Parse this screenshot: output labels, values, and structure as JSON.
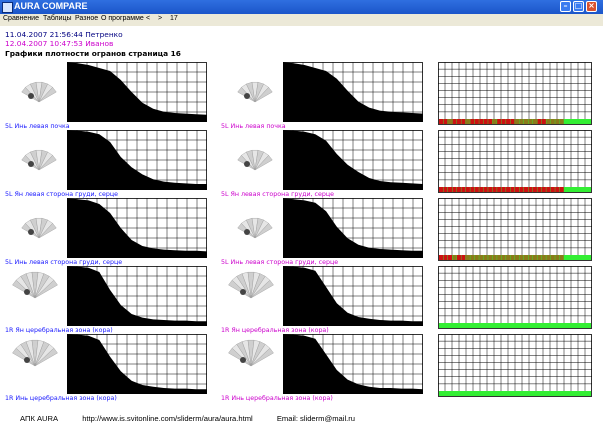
{
  "window": {
    "title": "AURA COMPARE"
  },
  "menu": [
    "Сравнение",
    "Таблицы",
    "Разное",
    "О программе",
    "<",
    ">",
    "17"
  ],
  "header": {
    "record1": "11.04.2007 21:56:44 Петренко",
    "record2": "12.04.2007 10:47:53 Иванов",
    "heading": "Графики плотности огранов  страница 16"
  },
  "colors": {
    "record1": "#000080",
    "record2": "#cc00cc",
    "band_green": "#33ee33",
    "band_red": "#cc1111",
    "band_olive": "#8a7a1a"
  },
  "rows": [
    {
      "left": {
        "label": "5L Инь левая почка",
        "color": "#1a1aff",
        "thumb": "fan-small",
        "curve": [
          1.0,
          0.98,
          0.95,
          0.9,
          0.85,
          0.7,
          0.5,
          0.32,
          0.22,
          0.17,
          0.15,
          0.14,
          0.13,
          0.12
        ]
      },
      "right": {
        "label": "5L Инь левая почка",
        "color": "#cc00cc",
        "thumb": "fan-small",
        "curve": [
          1.0,
          0.98,
          0.95,
          0.9,
          0.85,
          0.72,
          0.52,
          0.34,
          0.24,
          0.19,
          0.17,
          0.16,
          0.15,
          0.14
        ]
      },
      "strip": {
        "band": "mixed",
        "pattern": [
          1,
          1,
          0,
          1,
          1,
          1,
          0,
          1,
          1,
          1,
          1,
          1,
          0,
          1,
          1,
          1,
          1,
          0,
          0,
          0,
          0,
          0,
          1,
          1,
          0,
          0,
          0,
          0
        ]
      }
    },
    {
      "left": {
        "label": "5L Ян левая сторона груди, серце",
        "color": "#1a1aff",
        "thumb": "fan-small",
        "curve": [
          1.0,
          0.99,
          0.97,
          0.93,
          0.8,
          0.55,
          0.38,
          0.26,
          0.18,
          0.14,
          0.12,
          0.11,
          0.1,
          0.1
        ]
      },
      "right": {
        "label": "5L Ян левая сторона груди, серце",
        "color": "#cc00cc",
        "thumb": "fan-small",
        "curve": [
          1.0,
          0.99,
          0.97,
          0.93,
          0.82,
          0.6,
          0.42,
          0.3,
          0.2,
          0.15,
          0.13,
          0.12,
          0.11,
          0.1
        ]
      },
      "strip": {
        "band": "mixed",
        "pattern": [
          1,
          1,
          1,
          1,
          1,
          1,
          1,
          1,
          1,
          1,
          1,
          1,
          1,
          1,
          1,
          1,
          1,
          1,
          1,
          1,
          1,
          1,
          1,
          1,
          1,
          1,
          1,
          1
        ]
      }
    },
    {
      "left": {
        "label": "5L Инь левая сторона груди, серце",
        "color": "#1a1aff",
        "thumb": "fan-small",
        "curve": [
          1.0,
          0.98,
          0.96,
          0.9,
          0.75,
          0.5,
          0.3,
          0.2,
          0.16,
          0.14,
          0.13,
          0.12,
          0.12,
          0.11
        ]
      },
      "right": {
        "label": "5L Инь левая сторона груди, серце",
        "color": "#cc00cc",
        "thumb": "fan-small",
        "curve": [
          1.0,
          0.98,
          0.96,
          0.92,
          0.78,
          0.52,
          0.33,
          0.22,
          0.17,
          0.15,
          0.14,
          0.13,
          0.12,
          0.12
        ]
      },
      "strip": {
        "band": "mixed",
        "pattern": [
          1,
          1,
          1,
          0,
          1,
          1,
          0,
          0,
          0,
          0,
          0,
          0,
          0,
          0,
          0,
          0,
          0,
          0,
          0,
          0,
          0,
          0,
          0,
          0,
          0,
          0,
          0,
          0
        ]
      }
    },
    {
      "left": {
        "label": "1R Ян церебральная зона (кора)",
        "color": "#1a1aff",
        "thumb": "fan-large",
        "curve": [
          1.0,
          0.99,
          0.97,
          0.9,
          0.6,
          0.35,
          0.2,
          0.14,
          0.11,
          0.1,
          0.09,
          0.09,
          0.08,
          0.08
        ]
      },
      "right": {
        "label": "1R Ян церебральная зона (кора)",
        "color": "#cc00cc",
        "thumb": "fan-large",
        "curve": [
          1.0,
          0.99,
          0.97,
          0.92,
          0.65,
          0.38,
          0.22,
          0.15,
          0.12,
          0.1,
          0.09,
          0.09,
          0.08,
          0.08
        ]
      },
      "strip": {
        "band": "green",
        "pattern": []
      }
    },
    {
      "left": {
        "label": "1R Инь церебральная зона (кора)",
        "color": "#1a1aff",
        "thumb": "fan-large",
        "curve": [
          1.0,
          0.99,
          0.97,
          0.9,
          0.62,
          0.38,
          0.22,
          0.15,
          0.12,
          0.1,
          0.09,
          0.09,
          0.08,
          0.08
        ]
      },
      "right": {
        "label": "1R Инь церебральная зона (кора)",
        "color": "#cc00cc",
        "thumb": "fan-large",
        "curve": [
          1.0,
          0.99,
          0.97,
          0.92,
          0.66,
          0.4,
          0.24,
          0.16,
          0.12,
          0.1,
          0.1,
          0.09,
          0.09,
          0.08
        ]
      },
      "strip": {
        "band": "green",
        "pattern": []
      }
    }
  ],
  "footer": {
    "brand": "АПК AURA",
    "url": "http://www.is.svitonline.com/sliderm/aura/aura.html",
    "email": "Email: sliderm@mail.ru"
  }
}
